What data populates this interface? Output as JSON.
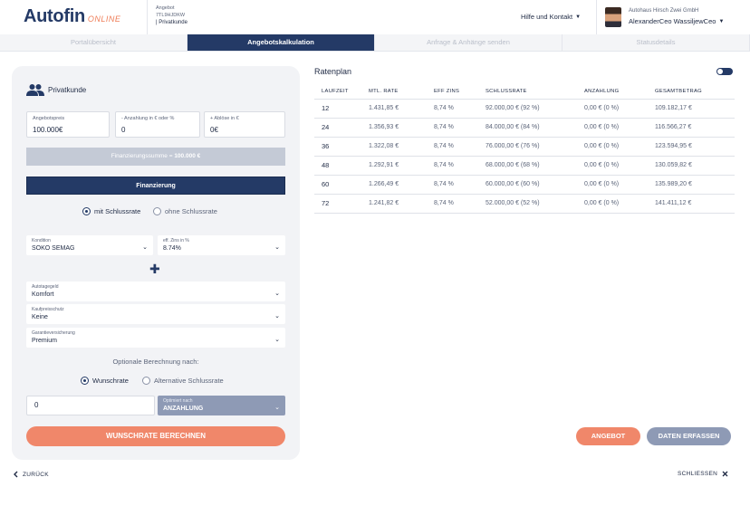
{
  "brand": {
    "name": "Autofin",
    "suffix": "ONLINE"
  },
  "offer": {
    "label": "Angebot",
    "id": "7TL9HJDKW",
    "type": "| Privatkunde"
  },
  "header": {
    "help_menu": "Hilfe und Kontakt",
    "dealer": "Autohaus Hirsch Zwei GmbH",
    "user": "AlexanderCeo WassiljewCeo"
  },
  "tabs": [
    {
      "label": "Portalübersicht"
    },
    {
      "label": "Angebotskalkulation"
    },
    {
      "label": "Anfrage & Anhänge senden"
    },
    {
      "label": "Statusdetails"
    }
  ],
  "form": {
    "customer_type": "Privatkunde",
    "price": {
      "label": "Angebotspreis",
      "value": "100.000€"
    },
    "down_payment": {
      "label": "- Anzahlung in € oder %",
      "value": "0"
    },
    "trade_in": {
      "label": "+ Ablöse in €",
      "value": "0€"
    },
    "sum_label": "Finanzierungssumme = ",
    "sum_value": "100.000 €",
    "finance_button": "Finanzierung",
    "radio_with": "mit Schlussrate",
    "radio_without": "ohne Schlussrate",
    "condition": {
      "label": "Kondition",
      "value": "SOKO SEMAG"
    },
    "interest": {
      "label": "eff. Zins in %",
      "value": "8.74%"
    },
    "gap": {
      "label": "Autotagegeld",
      "value": "Komfort"
    },
    "purchase_protection": {
      "label": "Kaufpreisschutz",
      "value": "Keine"
    },
    "warranty": {
      "label": "Garantieversicherung",
      "value": "Premium"
    },
    "optional_title": "Optionale Berechnung nach:",
    "radio_wish": "Wunschrate",
    "radio_alt": "Alternative Schlussrate",
    "wish_value": "0",
    "optimize": {
      "label": "Optimiert nach",
      "value": "ANZAHLUNG"
    },
    "calc_button": "WUNSCHRATE BERECHNEN"
  },
  "ratenplan": {
    "title": "Ratenplan",
    "headers": [
      "LAUFZEIT",
      "MTL. RATE",
      "EFF ZINS",
      "SCHLUSSRATE",
      "ANZAHLUNG",
      "GESAMTBETRAG"
    ],
    "rows": [
      [
        "12",
        "1.431,85 €",
        "8,74 %",
        "92.000,00 € (92 %)",
        "0,00 € (0 %)",
        "109.182,17 €"
      ],
      [
        "24",
        "1.356,93 €",
        "8,74 %",
        "84.000,00 € (84 %)",
        "0,00 € (0 %)",
        "116.566,27 €"
      ],
      [
        "36",
        "1.322,08 €",
        "8,74 %",
        "76.000,00 € (76 %)",
        "0,00 € (0 %)",
        "123.594,95 €"
      ],
      [
        "48",
        "1.292,91 €",
        "8,74 %",
        "68.000,00 € (68 %)",
        "0,00 € (0 %)",
        "130.059,82 €"
      ],
      [
        "60",
        "1.266,49 €",
        "8,74 %",
        "60.000,00 € (60 %)",
        "0,00 € (0 %)",
        "135.989,20 €"
      ],
      [
        "72",
        "1.241,82 €",
        "8,74 %",
        "52.000,00 € (52 %)",
        "0,00 € (0 %)",
        "141.411,12 €"
      ]
    ]
  },
  "actions": {
    "offer": "ANGEBOT",
    "capture": "DATEN ERFASSEN"
  },
  "footer": {
    "back": "ZURÜCK",
    "close": "SCHLIESSEN"
  },
  "colors": {
    "primary": "#243a66",
    "accent": "#f0876a",
    "muted_button": "#8e9ab5"
  }
}
